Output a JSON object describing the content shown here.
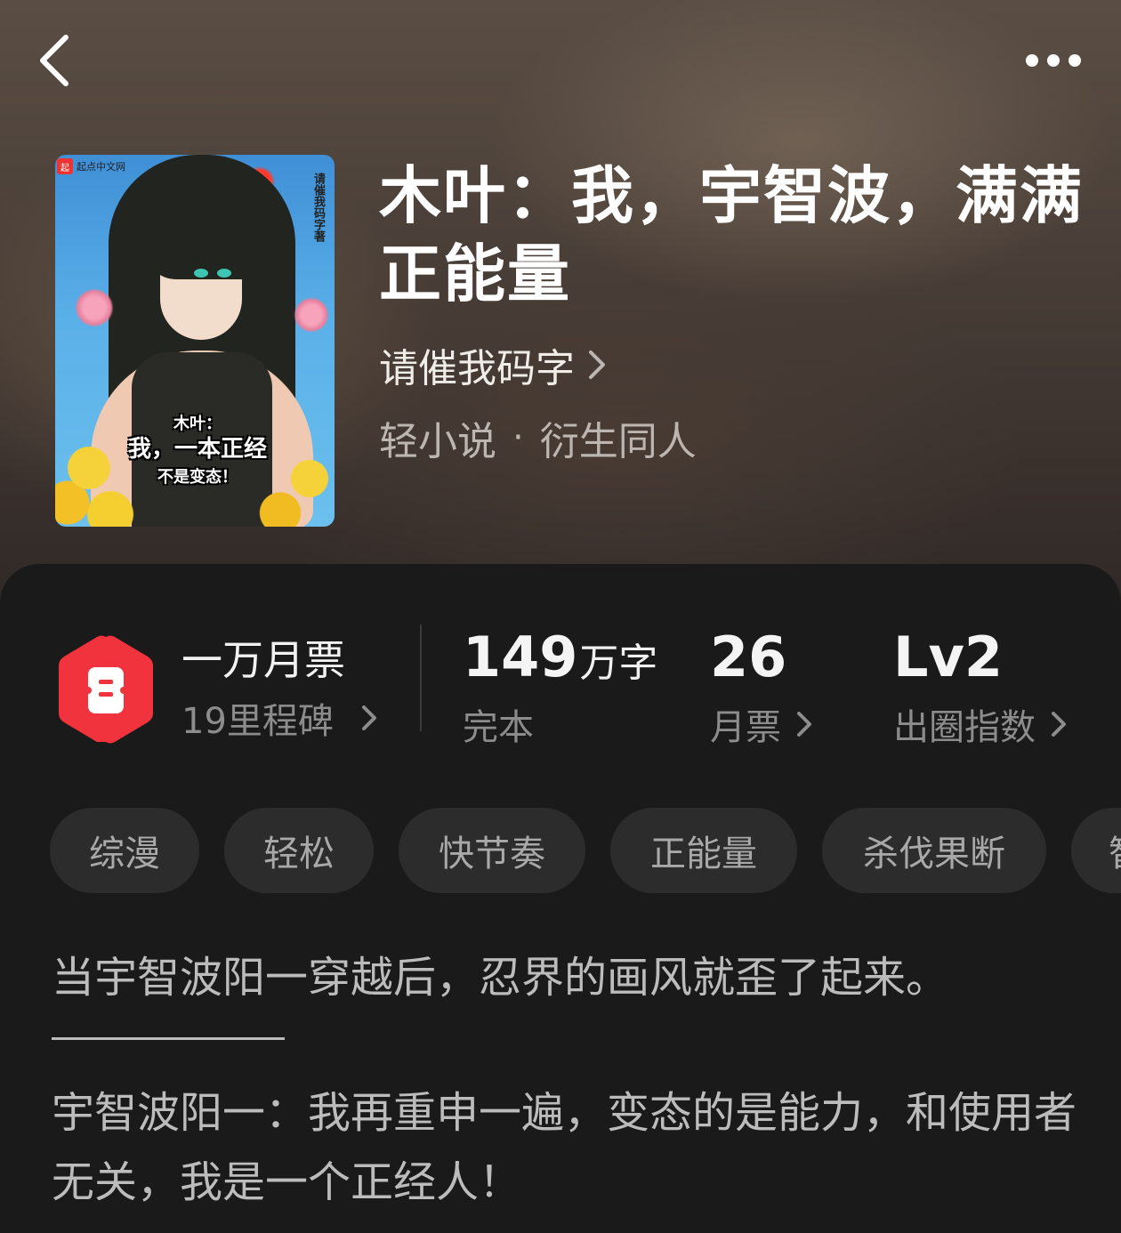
{
  "header": {
    "back_icon": "chevron-left-icon",
    "more_icon": "more-dots-icon"
  },
  "book": {
    "title": "木叶：我，宇智波，满满正能量",
    "author": "请催我码字",
    "category": "轻小说",
    "subcategory": "衍生同人",
    "separator": "·",
    "cover": {
      "site_label": "起点中文网",
      "author_vertical": "请催我码字著",
      "art_line1": "木叶：",
      "art_line2": "我，一本正经",
      "art_line3": "不是变态！"
    }
  },
  "stats": {
    "monthly_ticket_title": "一万月票",
    "milestones": "19里程碑",
    "word_count": "149",
    "word_unit": "万字",
    "status": "完本",
    "votes_value": "26",
    "votes_label": "月票",
    "circle_value": "Lv2",
    "circle_label": "出圈指数"
  },
  "tags": [
    "综漫",
    "轻松",
    "快节奏",
    "正能量",
    "杀伐果断",
    "智"
  ],
  "description": {
    "line1": "当宇智波阳一穿越后，忍界的画风就歪了起来。",
    "paragraph": "宇智波阳一：我再重申一遍，变态的是能力，和使用者无关，我是一个正经人！"
  },
  "colors": {
    "accent_red": "#f0333d",
    "card_bg": "#1a1a1a",
    "tag_bg": "#2c2c2c"
  }
}
